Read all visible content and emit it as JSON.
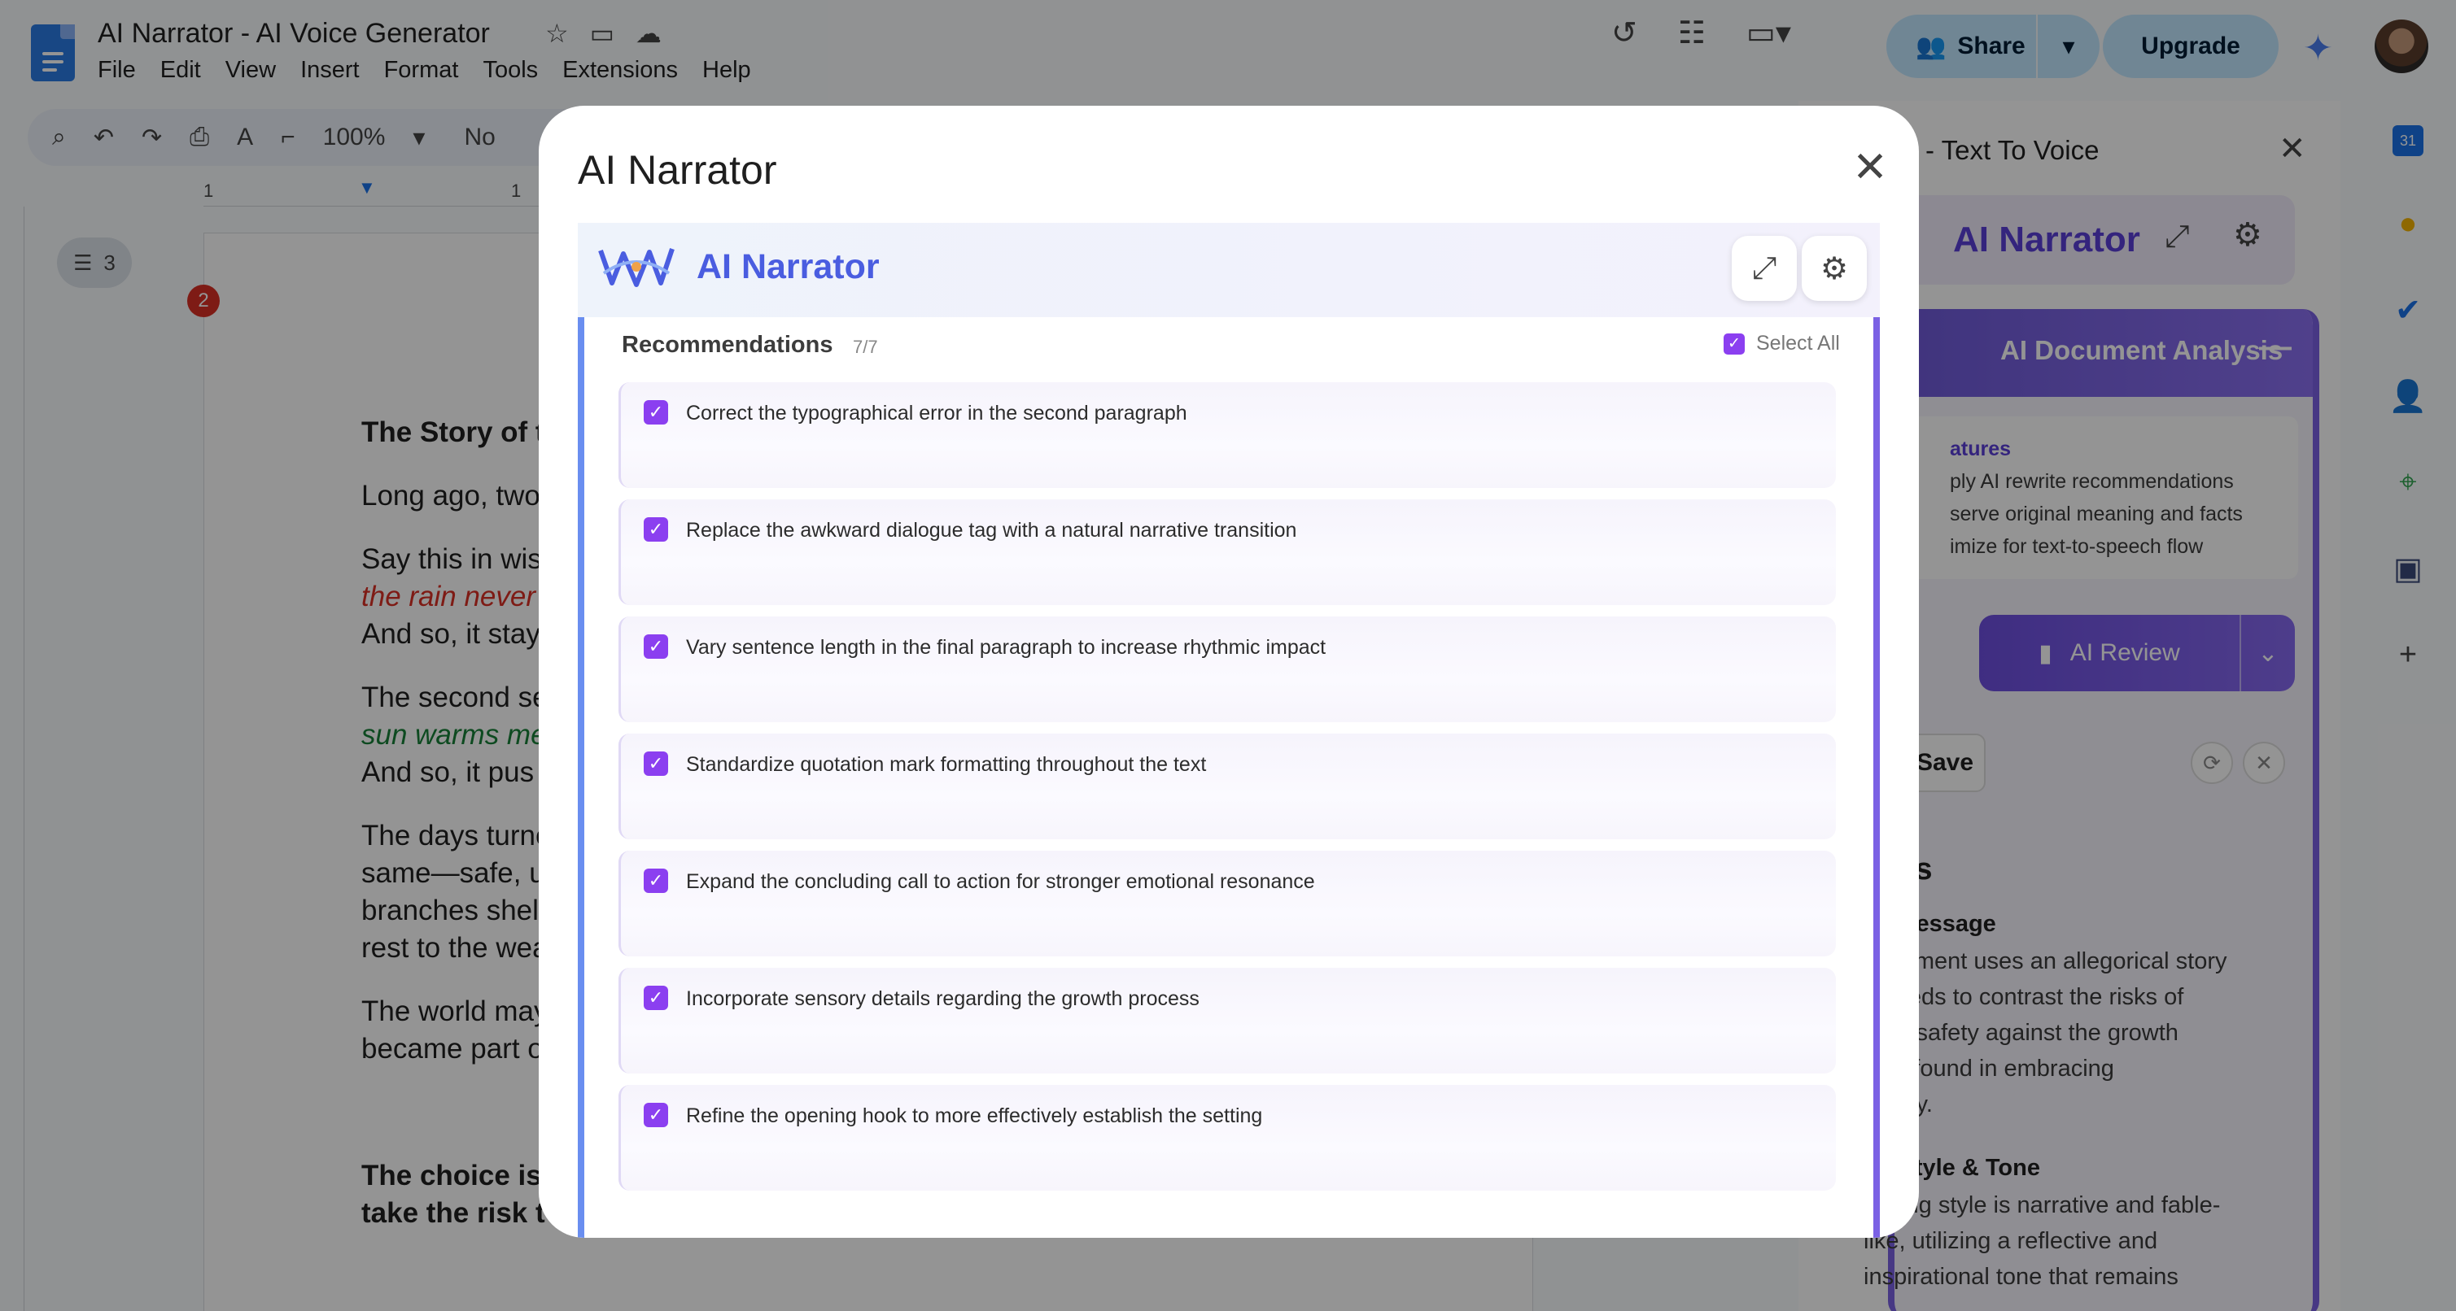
{
  "docs": {
    "title": "AI Narrator - AI Voice Generator",
    "menu": [
      "File",
      "Edit",
      "View",
      "Insert",
      "Format",
      "Tools",
      "Extensions",
      "Help"
    ],
    "zoom": "100%",
    "style_partial": "No",
    "share_label": "Share",
    "upgrade_label": "Upgrade",
    "outline_count": "3",
    "comment_count": "2",
    "ruler_marks": [
      "1",
      "1"
    ],
    "lines": [
      "The Story of t",
      "Long ago, two",
      "Say this in wis",
      "the rain never",
      " And so, it stay",
      "The second se",
      "sun warms me",
      " And so, it pus",
      "The days turne",
      "same—safe, u",
      "branches shel",
      "rest to the wea",
      "The world may",
      "became part o",
      "The choice is",
      "take the risk t"
    ]
  },
  "sidebar": {
    "title": "ator - Text To Voice",
    "brand": "AI Narrator",
    "analysis_header": "AI Document Analysis",
    "features_heading": "atures",
    "features": [
      "ply AI rewrite recommendations",
      "serve original meaning and facts",
      "imize for text-to-speech flow"
    ],
    "ai_review_label": "AI Review",
    "save_label": "Save",
    "analysis_heading": "lysis",
    "overall_heading": "all Message",
    "overall_lines": [
      "document uses an allegorical story",
      "o seeds to contrast the risks of",
      "nant safety against the growth",
      "ntial found in embracing",
      "rtainty."
    ],
    "style_heading": "ng Style & Tone",
    "style_lines": [
      " writing style is narrative and fable-",
      "like, utilizing a reflective and",
      "inspirational tone that remains"
    ]
  },
  "modal": {
    "title": "AI Narrator",
    "plugin_name": "AI Narrator",
    "recommendations_title": "Recommendations",
    "recommendations_count": "7/7",
    "select_all_label": "Select All",
    "recommendations": [
      "Correct the typographical error in the second paragraph",
      "Replace the awkward dialogue tag with a natural narrative transition",
      "Vary sentence length in the final paragraph to increase rhythmic impact",
      "Standardize quotation mark formatting throughout the text",
      "Expand the concluding call to action for stronger emotional resonance",
      "Incorporate sensory details regarding the growth process",
      "Refine the opening hook to more effectively establish the setting"
    ]
  },
  "icons": {
    "check": "✓",
    "close": "✕",
    "star": "☆",
    "history": "↺",
    "chat": "☷",
    "gear": "⚙",
    "expand": "⤢"
  },
  "colors": {
    "accent_purple": "#8b3ff0",
    "brand_blue": "#4a5de0",
    "share_bg": "#c2e7ff"
  }
}
